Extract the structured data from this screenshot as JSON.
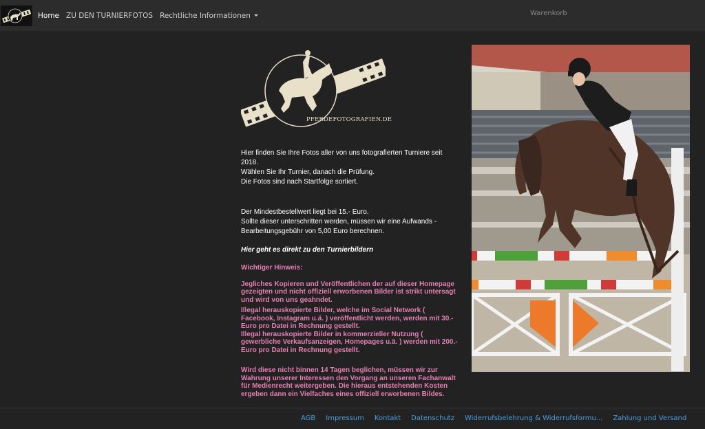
{
  "nav": {
    "items": [
      {
        "label": "Home",
        "active": true
      },
      {
        "label": "ZU DEN TURNIERFOTOS"
      },
      {
        "label": "Rechtliche Informationen",
        "dropdown": true
      }
    ],
    "cart": "Warenkorb"
  },
  "logo": {
    "text": "PFERDEFOTOGRAFIEN.DE"
  },
  "intro": [
    "Hier finden Sie Ihre Fotos aller von uns fotografierten Turniere seit 2018.",
    "Wählen Sie Ihr Turnier, danach die Prüfung.",
    "Die Fotos sind nach Startfolge sortiert."
  ],
  "min_order": [
    "Der Mindestbestellwert liegt bei 15.- Euro.",
    "Sollte dieser unterschritten werden, müssen wir eine Aufwands -",
    "Bearbeitungsgebühr von 5,00  Euro berechnen."
  ],
  "direct_link": "Hier geht es direkt zu den Turnierbildern",
  "notice": {
    "heading": "Wichtiger Hinweis:",
    "p1": "Jegliches Kopieren und Veröffentlichen der auf dieser Homepage gezeigten und nicht offiziell erworbenen Bilder ist strikt untersagt und wird von uns geahndet.",
    "p2": "Illegal herauskopierte Bilder, welche im Social Network ( Facebook, Instagram u.ä. ) veröffentlicht werden, werden mit 30.- Euro pro Datei in Rechnung gestellt.",
    "p3": "Illegal herauskopierte Bilder in kommerzieller Nutzung ( gewerbliche Verkaufsanzeigen, Homepages u.ä. ) werden mit 200.- Euro pro Datei in Rechnung gestellt.",
    "p4": "Wird diese nicht binnen 14 Tagen beglichen, müssen wir zur Wahrung unserer Interessen den Vorgang an unseren Fachanwalt für Medienrecht weitergeben. Die hieraus entstehenden Kosten ergeben dann ein Vielfaches eines offiziell erworbenen Bildes."
  },
  "footer": {
    "links": [
      "AGB",
      "Impressum",
      "Kontakt",
      "Datenschutz",
      "Widerrufsbelehrung & Widerrufsformu...",
      "Zahlung und Versand"
    ]
  },
  "colors": {
    "notice": "#e67fb5",
    "footer_link": "#4a9fe0",
    "background": "#222222",
    "navbar": "#2c2c2c"
  }
}
